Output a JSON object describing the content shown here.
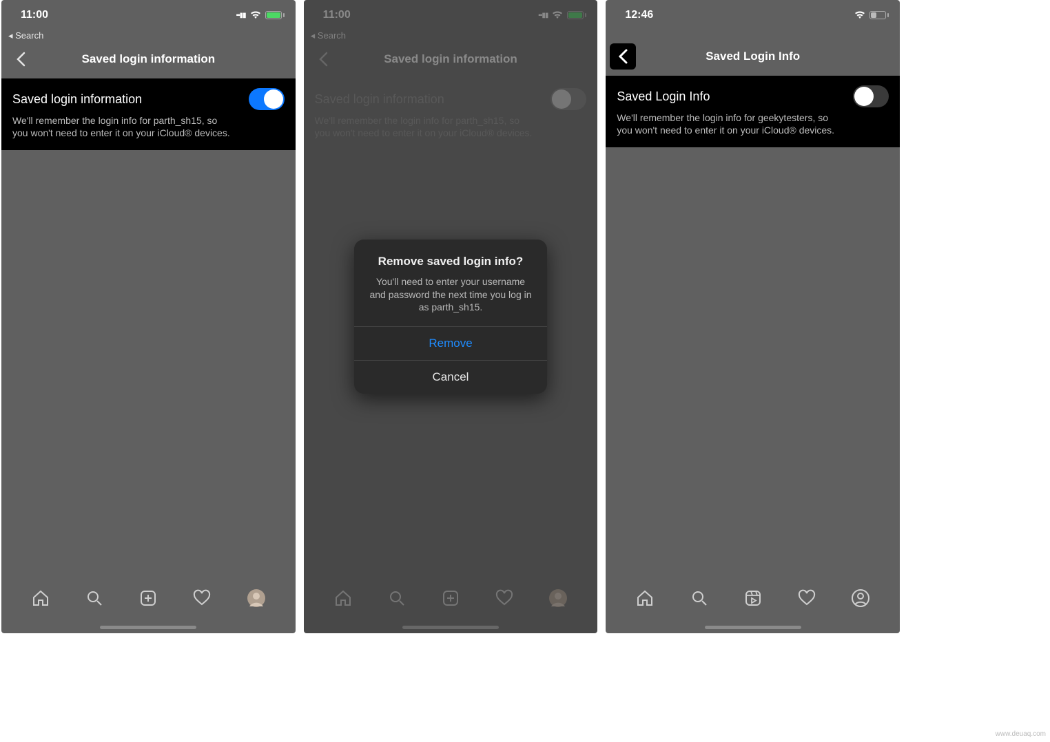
{
  "statusbar": {
    "time12": "11:00",
    "time3": "12:46",
    "back_search": "◂ Search"
  },
  "screen1": {
    "header_title": "Saved login information",
    "card_title": "Saved login information",
    "card_desc": "We'll remember the login info for parth_sh15, so you won't need to enter it on your iCloud® devices.",
    "toggle_on": true
  },
  "screen2": {
    "header_title": "Saved login information",
    "card_title": "Saved login information",
    "card_desc": "We'll remember the login info for parth_sh15, so you won't need to enter it on your iCloud® devices.",
    "modal": {
      "title": "Remove saved login info?",
      "body": "You'll need to enter your username and password the next time you log in as parth_sh15.",
      "primary": "Remove",
      "secondary": "Cancel"
    }
  },
  "screen3": {
    "header_title": "Saved Login Info",
    "card_title": "Saved Login Info",
    "card_desc": "We'll remember the login info for geekytesters, so you won't need to enter it on your iCloud® devices.",
    "toggle_on": false
  },
  "watermark": "www.deuaq.com"
}
